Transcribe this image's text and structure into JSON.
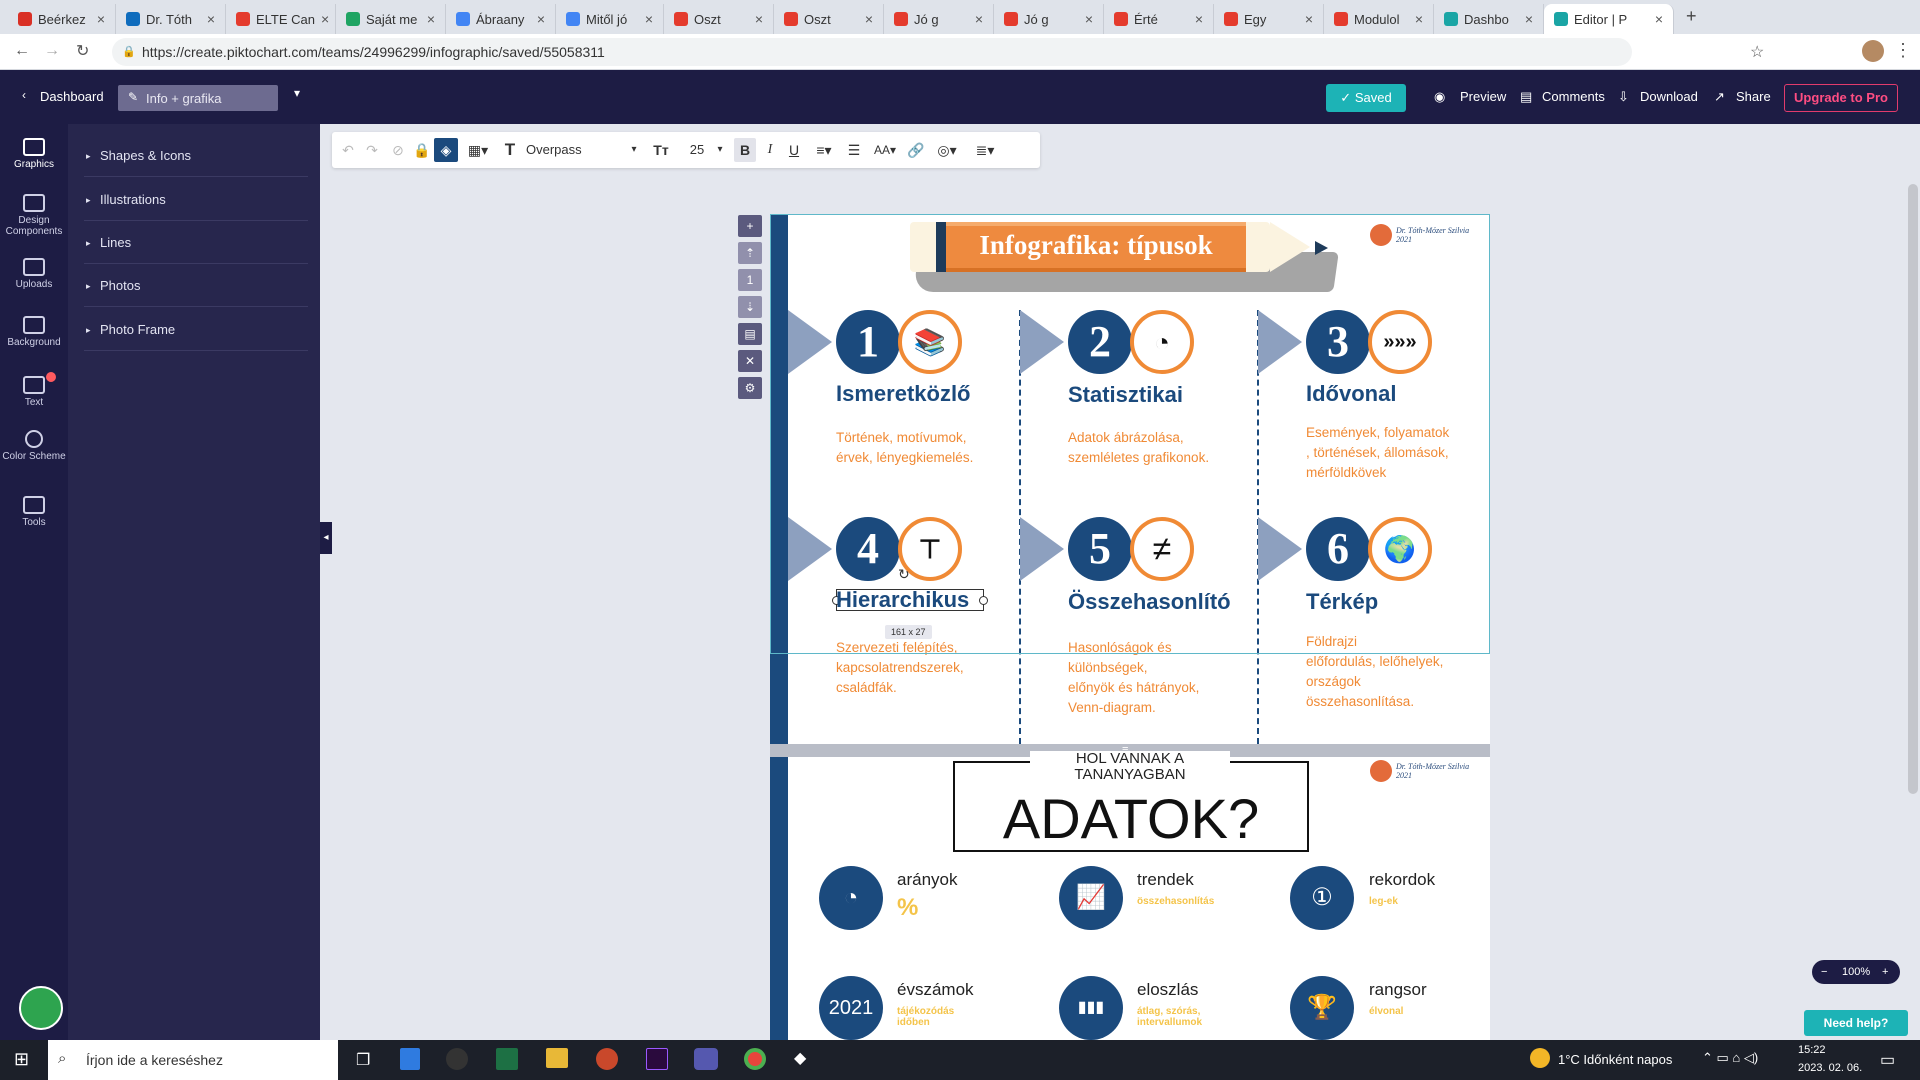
{
  "browser": {
    "tabs": [
      {
        "label": "Beérkez",
        "color": "#d93025"
      },
      {
        "label": "Dr. Tóth",
        "color": "#0f6cbd"
      },
      {
        "label": "ELTE Can",
        "color": "#e43b2d"
      },
      {
        "label": "Saját me",
        "color": "#1fa463"
      },
      {
        "label": "Ábraany",
        "color": "#4285f4"
      },
      {
        "label": "Mitől jó",
        "color": "#4285f4"
      },
      {
        "label": "Oszt",
        "color": "#e43b2d"
      },
      {
        "label": "Oszt",
        "color": "#e43b2d"
      },
      {
        "label": "Jó g",
        "color": "#e43b2d"
      },
      {
        "label": "Jó g",
        "color": "#e43b2d"
      },
      {
        "label": "Érté",
        "color": "#e43b2d"
      },
      {
        "label": "Egy",
        "color": "#e43b2d"
      },
      {
        "label": "Modulol",
        "color": "#e43b2d"
      },
      {
        "label": "Dashbo",
        "color": "#1aa5a5"
      },
      {
        "label": "Editor | P",
        "color": "#1aa5a5"
      }
    ],
    "url": "https://create.piktochart.com/teams/24996299/infographic/saved/55058311"
  },
  "header": {
    "dashboard_label": "Dashboard",
    "doc_title": "Info + grafika",
    "saved_label": "Saved",
    "preview_label": "Preview",
    "comments_label": "Comments",
    "download_label": "Download",
    "share_label": "Share",
    "upgrade_label": "Upgrade to Pro"
  },
  "rail": [
    "Graphics",
    "Design Components",
    "Uploads",
    "Background",
    "Text",
    "Color Scheme",
    "Tools"
  ],
  "panel": [
    "Shapes & Icons",
    "Illustrations",
    "Lines",
    "Photos",
    "Photo Frame"
  ],
  "toolbar": {
    "font": "Overpass",
    "size": "25"
  },
  "infographic": {
    "title": "Infografika: típusok",
    "author": "Dr. Tóth-Mózer Szilvia",
    "year": "2021",
    "types": [
      {
        "n": "1",
        "title": "Ismeretközlő",
        "desc": "Történek, motívumok,\nérvek, lényegkiemelés.",
        "icon": "📚"
      },
      {
        "n": "2",
        "title": "Statisztikai",
        "desc": "Adatok ábrázolása,\nszemléletes grafikonok.",
        "icon": "◔"
      },
      {
        "n": "3",
        "title": "Idővonal",
        "desc": "Események, folyamatok\n, történések, állomások,\nmérföldkövek",
        "icon": "»»»"
      },
      {
        "n": "4",
        "title": "Hierarchikus",
        "desc": "Szervezeti felépítés,\nkapcsolatrendszerek,\ncsaládfák.",
        "icon": "⊤"
      },
      {
        "n": "5",
        "title": "Összehasonlító",
        "desc": "Hasonlóságok és\nkülönbségek,\nelőnyök és hátrányok,\nVenn-diagram.",
        "icon": "≠"
      },
      {
        "n": "6",
        "title": "Térkép",
        "desc": "Földrajzi\nelőfordulás, lelőhelyek,\nországok\nösszehasonlítása.",
        "icon": "🌍"
      }
    ],
    "selection_size": "161 x 27",
    "page2_kicker": "HOL VANNAK A TANANYAGBAN",
    "page2_title": "ADATOK?",
    "data_items": [
      {
        "label": "arányok",
        "sub": "%",
        "icon": "◔"
      },
      {
        "label": "trendek",
        "sub": "összehasonlítás",
        "icon": "📈"
      },
      {
        "label": "rekordok",
        "sub": "leg-ek",
        "icon": "①"
      },
      {
        "label": "évszámok",
        "sub": "tájékozódás időben",
        "icon": "2021"
      },
      {
        "label": "eloszlás",
        "sub": "átlag, szórás, intervallumok",
        "icon": "▮▮▮"
      },
      {
        "label": "rangsor",
        "sub": "élvonal",
        "icon": "🏆"
      }
    ]
  },
  "zoom": "100%",
  "help_label": "Need help?",
  "taskbar": {
    "search_placeholder": "Írjon ide a kereséshez",
    "weather": "1°C  Időnként napos",
    "time": "15:22",
    "date": "2023. 02. 06."
  }
}
